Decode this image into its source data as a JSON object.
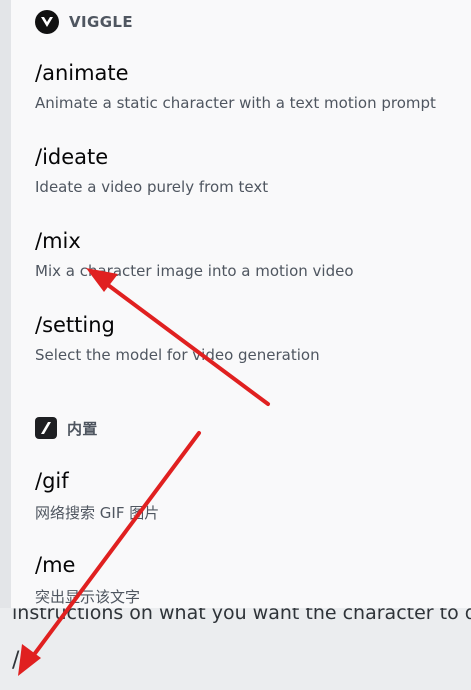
{
  "chat": {
    "partial_message": "instructions on what you want the character to do",
    "input_value": "/"
  },
  "popup": {
    "sections": [
      {
        "title": "VIGGLE",
        "icon": "viggle-logo-icon",
        "commands": [
          {
            "name": "/animate",
            "description": "Animate a static character with a text motion prompt"
          },
          {
            "name": "/ideate",
            "description": "Ideate a video purely from text"
          },
          {
            "name": "/mix",
            "description": "Mix a character image into a motion video"
          },
          {
            "name": "/setting",
            "description": "Select the model for video generation"
          }
        ]
      },
      {
        "title": "内置",
        "icon": "builtin-slash-icon",
        "commands": [
          {
            "name": "/gif",
            "description": "网络搜索 GIF 图片"
          },
          {
            "name": "/me",
            "description": "突出显示该文字"
          }
        ]
      }
    ]
  },
  "colors": {
    "annotation_arrow": "#e02020",
    "popup_bg": "#f9f9fa",
    "page_bg": "#ebedef"
  }
}
